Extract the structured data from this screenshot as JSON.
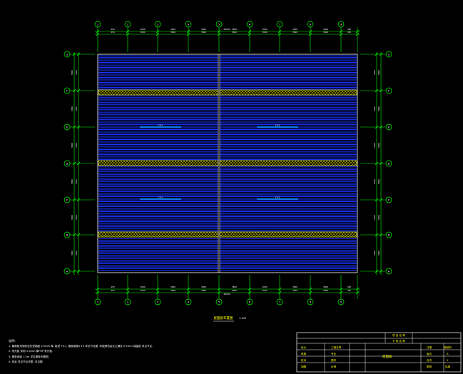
{
  "drawing": {
    "title": "屋面板布置图",
    "scale": "1:100",
    "dimension_total_top": "36000",
    "dimension_total_bottom": "36000"
  },
  "axes": {
    "columns": [
      "1",
      "2",
      "3",
      "4",
      "5",
      "6",
      "7",
      "8",
      "9"
    ],
    "rows": [
      "G",
      "F",
      "E",
      "D",
      "C",
      "B",
      "A"
    ],
    "column_spacings": [
      "450",
      "3600",
      "3600",
      "3600",
      "3600",
      "3600",
      "3600",
      "3600",
      "450"
    ],
    "row_spacings": [
      "3300",
      "3300",
      "3300",
      "3300",
      "3300",
      "3300"
    ]
  },
  "plan": {
    "panel_labels": [
      "YX-1",
      "YX-1",
      "YX-1",
      "YX-1"
    ],
    "colors": {
      "outline": "#ffffff",
      "roof_sheet": "#1a33ff",
      "skylight": "#ffff00",
      "axis": "#00ff00",
      "dimension": "#00ff00",
      "label_line": "#00ffff"
    }
  },
  "notes": {
    "heading": "说明:",
    "items": [
      "1. 屋面板采用彩色压型钢板 0.5mm 厚, 板型 YX-1, 屋面坡度1:15 详见节点图, 彩板颜色由业主确定 0.5mm     保温层 详见节点.",
      "2. 采光板 采用 1.5mm 厚FRP 采光板.",
      "3. 檩条间距 1.5m    详见檩条布置图.",
      "4. 其余 详见节点详图.      详见图."
    ]
  },
  "title_block": {
    "left_labels": [
      "设计",
      "审核",
      "校对",
      "制图"
    ],
    "mid_labels": [
      "工程名称",
      "专业",
      "图号",
      "比例"
    ],
    "center_title": "屋面板",
    "right_labels": [
      "日期",
      "版次",
      "页次",
      "图别"
    ],
    "right_values": [
      "钢结构",
      "A",
      "1",
      "结施"
    ],
    "header_rows": [
      "项 目 名 称",
      "子 项 名 称"
    ]
  }
}
